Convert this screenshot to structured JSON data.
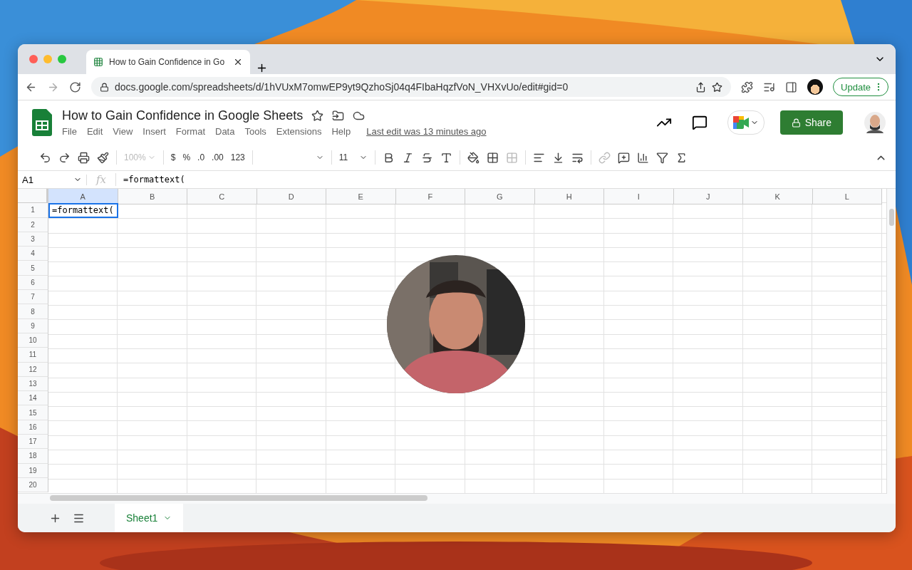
{
  "browser": {
    "tab_title": "How to Gain Confidence in Go",
    "url": "docs.google.com/spreadsheets/d/1hVUxM7omwEP9yt9QzhoSj04q4FIbaHqzfVoN_VHXvUo/edit#gid=0",
    "update_button": "Update"
  },
  "document": {
    "title": "How to Gain Confidence in Google Sheets",
    "menu": [
      "File",
      "Edit",
      "View",
      "Insert",
      "Format",
      "Data",
      "Tools",
      "Extensions",
      "Help"
    ],
    "last_edit": "Last edit was 13 minutes ago",
    "share_button": "Share"
  },
  "toolbar": {
    "zoom": {
      "label": "100%",
      "disabled": true
    },
    "format_buttons": [
      "$",
      "%",
      ".0",
      ".00",
      "123"
    ],
    "font_size": "11"
  },
  "formula_bar": {
    "cell_ref": "A1",
    "fx": "fx",
    "value": "=formattext("
  },
  "sheet": {
    "columns": [
      {
        "label": "A",
        "selected": true
      },
      {
        "label": "B",
        "selected": false
      },
      {
        "label": "C",
        "selected": false
      },
      {
        "label": "D",
        "selected": false
      },
      {
        "label": "E",
        "selected": false
      },
      {
        "label": "F",
        "selected": false
      },
      {
        "label": "G",
        "selected": false
      },
      {
        "label": "H",
        "selected": false
      },
      {
        "label": "I",
        "selected": false
      },
      {
        "label": "J",
        "selected": false
      },
      {
        "label": "K",
        "selected": false
      },
      {
        "label": "L",
        "selected": false
      }
    ],
    "rows": [
      {
        "label": "1",
        "cells": [
          {
            "value": "=formattext(",
            "editing": true
          }
        ]
      },
      {
        "label": "2"
      },
      {
        "label": "3"
      },
      {
        "label": "4"
      },
      {
        "label": "5"
      },
      {
        "label": "6"
      },
      {
        "label": "7"
      },
      {
        "label": "8"
      },
      {
        "label": "9"
      },
      {
        "label": "10"
      },
      {
        "label": "11"
      },
      {
        "label": "12"
      },
      {
        "label": "13"
      },
      {
        "label": "14"
      },
      {
        "label": "15"
      },
      {
        "label": "16"
      },
      {
        "label": "17"
      },
      {
        "label": "18"
      },
      {
        "label": "19"
      },
      {
        "label": "20"
      }
    ]
  },
  "sheet_tabs": [
    {
      "name": "Sheet1",
      "selected": true
    }
  ]
}
